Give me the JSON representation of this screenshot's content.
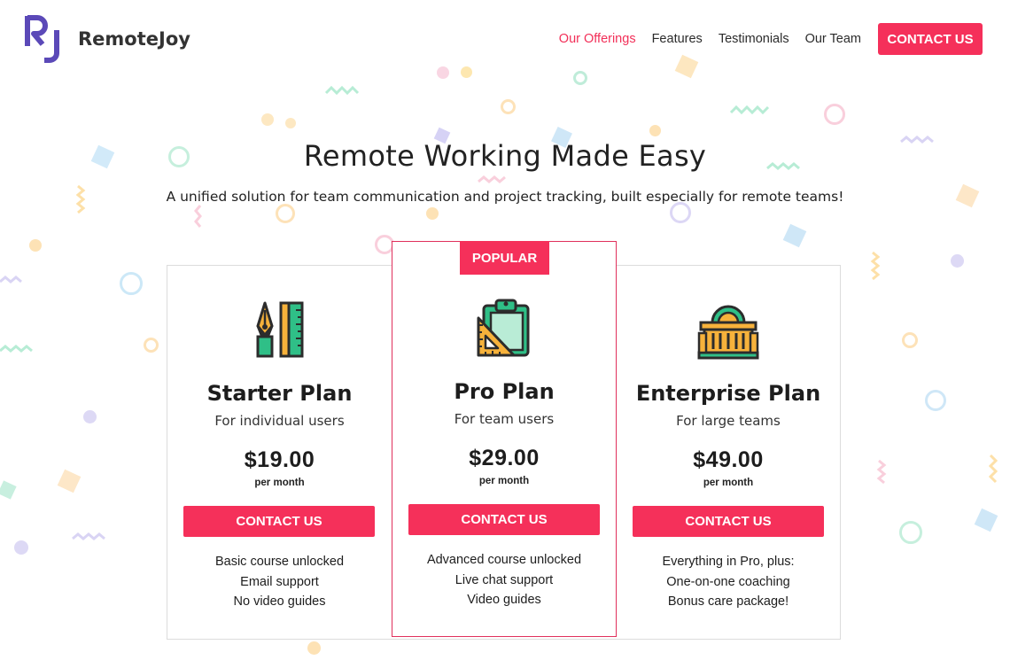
{
  "header": {
    "brand_mark": "RJ",
    "brand_name": "RemoteJoy",
    "nav": [
      {
        "label": "Our Offerings",
        "active": true
      },
      {
        "label": "Features",
        "active": false
      },
      {
        "label": "Testimonials",
        "active": false
      },
      {
        "label": "Our Team",
        "active": false
      }
    ],
    "cta_label": "CONTACT US"
  },
  "hero": {
    "title": "Remote Working Made Easy",
    "subtitle": "A unified solution for team communication and project tracking, built especially for remote teams!"
  },
  "plans": [
    {
      "icon": "pen-ruler-icon",
      "name": "Starter Plan",
      "audience": "For individual users",
      "price": "$19.00",
      "period": "per month",
      "cta_label": "CONTACT US",
      "features": [
        "Basic course unlocked",
        "Email support",
        "No video guides"
      ]
    },
    {
      "badge": "POPULAR",
      "icon": "clipboard-set-square-icon",
      "name": "Pro Plan",
      "audience": "For team users",
      "price": "$29.00",
      "period": "per month",
      "cta_label": "CONTACT US",
      "features": [
        "Advanced course unlocked",
        "Live chat support",
        "Video guides"
      ]
    },
    {
      "icon": "building-icon",
      "name": "Enterprise Plan",
      "audience": "For large teams",
      "price": "$49.00",
      "period": "per month",
      "cta_label": "CONTACT US",
      "features": [
        "Everything in Pro, plus:",
        "One-on-one coaching",
        "Bonus care package!"
      ]
    }
  ],
  "colors": {
    "accent": "#f5305a",
    "brand": "#5b49b8",
    "icon_yellow": "#f7b23b",
    "icon_green": "#2fbf87",
    "icon_outline": "#2c2c2c"
  }
}
